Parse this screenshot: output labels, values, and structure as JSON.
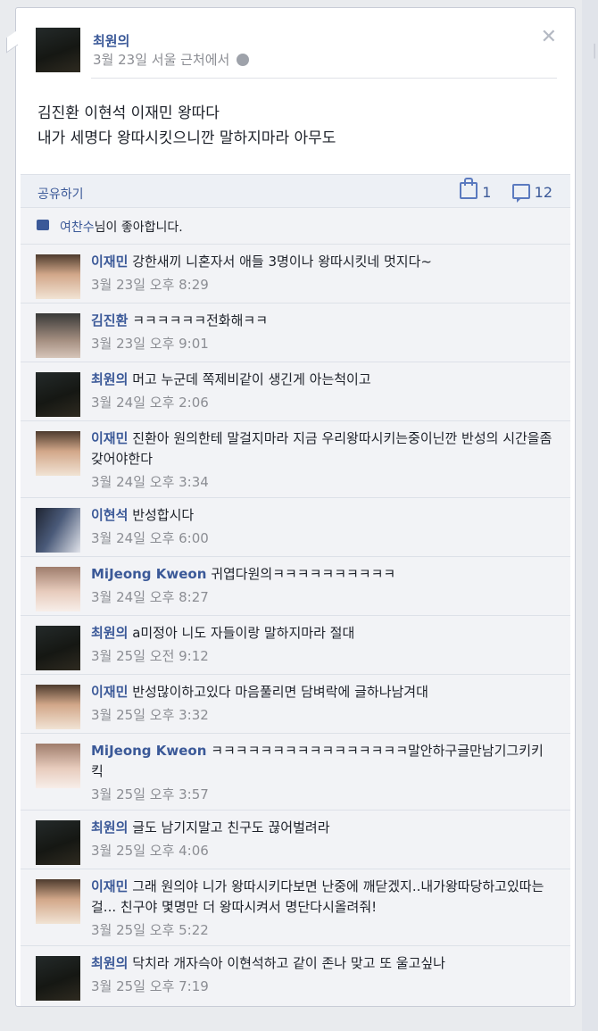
{
  "post": {
    "author": "최원의",
    "meta": "3월 23일 서울 근처에서",
    "lines": [
      "김진환 이현석 이재민 왕따다",
      "내가 세명다 왕따시킷으니깐 말하지마라 아무도"
    ],
    "share_label": "공유하기",
    "like_count": "1",
    "comment_count": "12",
    "likes": {
      "name": "여찬수",
      "suffix": "님이 좋아합니다."
    }
  },
  "comments": [
    {
      "author": "이재민",
      "text": "강한새끼 니혼자서 애들 3명이나 왕따시킷네 멋지다~",
      "time": "3월 23일 오후 8:29"
    },
    {
      "author": "김진환",
      "text": "ㅋㅋㅋㅋㅋㅋ전화해ㅋㅋ",
      "time": "3월 23일 오후 9:01"
    },
    {
      "author": "최원의",
      "text": "머고 누군데 쪽제비같이 생긴게 아는척이고",
      "time": "3월 24일 오후 2:06"
    },
    {
      "author": "이재민",
      "text": "진환아 원의한테 말걸지마라 지금 우리왕따시키는중이닌깐 반성의 시간을좀갖어야한다",
      "time": "3월 24일 오후 3:34"
    },
    {
      "author": "이현석",
      "text": "반성합시다",
      "time": "3월 24일 오후 6:00"
    },
    {
      "author": "MiJeong Kweon",
      "text": "귀엽다원의ㅋㅋㅋㅋㅋㅋㅋㅋㅋㅋ",
      "time": "3월 24일 오후 8:27"
    },
    {
      "author": "최원의",
      "text": "a미정아 니도 자들이랑 말하지마라 절대",
      "time": "3월 25일 오전 9:12"
    },
    {
      "author": "이재민",
      "text": "반성많이하고있다 마음풀리면 담벼락에 글하나남겨대",
      "time": "3월 25일 오후 3:32"
    },
    {
      "author": "MiJeong Kweon",
      "text": "ㅋㅋㅋㅋㅋㅋㅋㅋㅋㅋㅋㅋㅋㅋㅋㅋ말안하구글만남기그키키킥",
      "time": "3월 25일 오후 3:57"
    },
    {
      "author": "최원의",
      "text": "글도 남기지말고 친구도 끊어벌려라",
      "time": "3월 25일 오후 4:06"
    },
    {
      "author": "이재민",
      "text": "그래 원의야 니가 왕따시키다보면 난중에 깨닫겠지..내가왕따당하고있따는걸... 친구야 몇명만 더 왕따시켜서 명단다시올려줘!",
      "time": "3월 25일 오후 5:22"
    },
    {
      "author": "최원의",
      "text": "닥치라 개자슥아 이현석하고 같이 존나 맞고 또 울고싶나",
      "time": "3월 25일 오후 7:19"
    }
  ]
}
